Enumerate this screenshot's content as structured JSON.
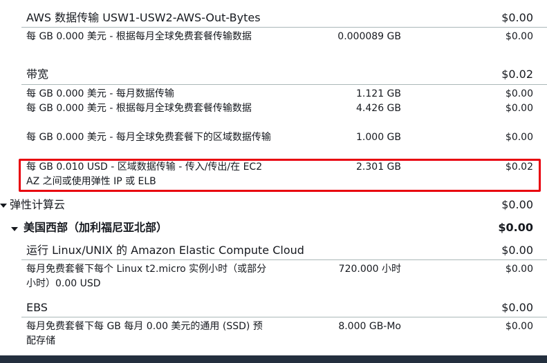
{
  "sections": {
    "aws_transfer": {
      "name": "AWS 数据传输 USW1-USW2-AWS-Out-Bytes",
      "amount": "$0.00"
    },
    "aws_transfer_item": {
      "desc": "每 GB 0.000 美元 - 根据每月全球免费套餐传输数据",
      "qty": "0.000089 GB",
      "amount": "$0.00"
    },
    "bandwidth": {
      "name": "带宽",
      "amount": "$0.02"
    },
    "bandwidth_items": [
      {
        "desc": "每 GB 0.000 美元 - 每月数据传输",
        "qty": "1.121 GB",
        "amount": "$0.00"
      },
      {
        "desc": "每 GB 0.000 美元 - 根据每月全球免费套餐传输数据",
        "qty": "4.426 GB",
        "amount": "$0.00"
      },
      {
        "desc": "每 GB 0.000 美元 - 每月全球免费套餐下的区域数据传输",
        "qty": "1.000 GB",
        "amount": "$0.00"
      },
      {
        "desc": "每 GB 0.010 USD - 区域数据传输 - 传入/传出/在 EC2 AZ 之间或使用弹性 IP 或 ELB",
        "qty": "2.301 GB",
        "amount": "$0.02"
      }
    ],
    "ec2": {
      "name": "弹性计算云",
      "amount": "$0.00"
    },
    "region": {
      "name": "美国西部（加利福尼亚北部）",
      "amount": "$0.00"
    },
    "linux": {
      "name": "运行 Linux/UNIX 的 Amazon Elastic Compute Cloud",
      "amount": "$0.00"
    },
    "linux_item": {
      "desc": "每月免费套餐下每个 Linux t2.micro 实例小时（或部分小时）0.00 USD",
      "qty": "720.000 小时",
      "amount": "$0.00"
    },
    "ebs": {
      "name": "EBS",
      "amount": "$0.00"
    },
    "ebs_item": {
      "desc": "每月免费套餐下每 GB 每月 0.00 美元的通用 (SSD) 预配存储",
      "qty": "8.000 GB-Mo",
      "amount": "$0.00"
    }
  },
  "colors": {
    "highlight": "#e8000d",
    "divider": "#aab7b8",
    "footer": "#232f3e"
  }
}
